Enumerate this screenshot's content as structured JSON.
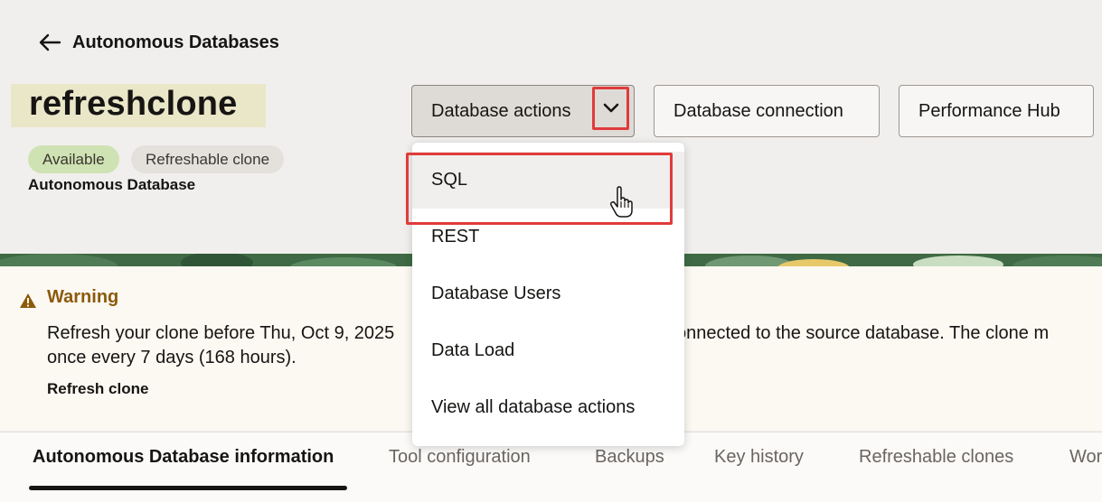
{
  "header": {
    "back_label": "Autonomous Databases",
    "title": "refreshclone",
    "badges": {
      "status": "Available",
      "type": "Refreshable clone"
    },
    "subtitle": "Autonomous Database"
  },
  "toolbar": {
    "db_actions_label": "Database actions",
    "db_connection_label": "Database connection",
    "perf_hub_label": "Performance Hub"
  },
  "menu": {
    "items": [
      {
        "label": "SQL"
      },
      {
        "label": "REST"
      },
      {
        "label": "Database Users"
      },
      {
        "label": "Data Load"
      },
      {
        "label": "View all database actions"
      }
    ]
  },
  "warning": {
    "title": "Warning",
    "text_line1_left": "Refresh your clone before Thu, Oct 9, 2025",
    "text_line1_right": "e connected to the source database. The clone m",
    "text_line2": "once every 7 days (168 hours).",
    "action": "Refresh clone"
  },
  "tabs": [
    {
      "label": "Autonomous Database information"
    },
    {
      "label": "Tool configuration"
    },
    {
      "label": "Backups"
    },
    {
      "label": "Key history"
    },
    {
      "label": "Refreshable clones"
    },
    {
      "label": "Wor"
    }
  ],
  "colors": {
    "highlight_red": "#e03b3b",
    "available_badge": "#cfe2b3",
    "warning_title": "#8c5a0b"
  }
}
